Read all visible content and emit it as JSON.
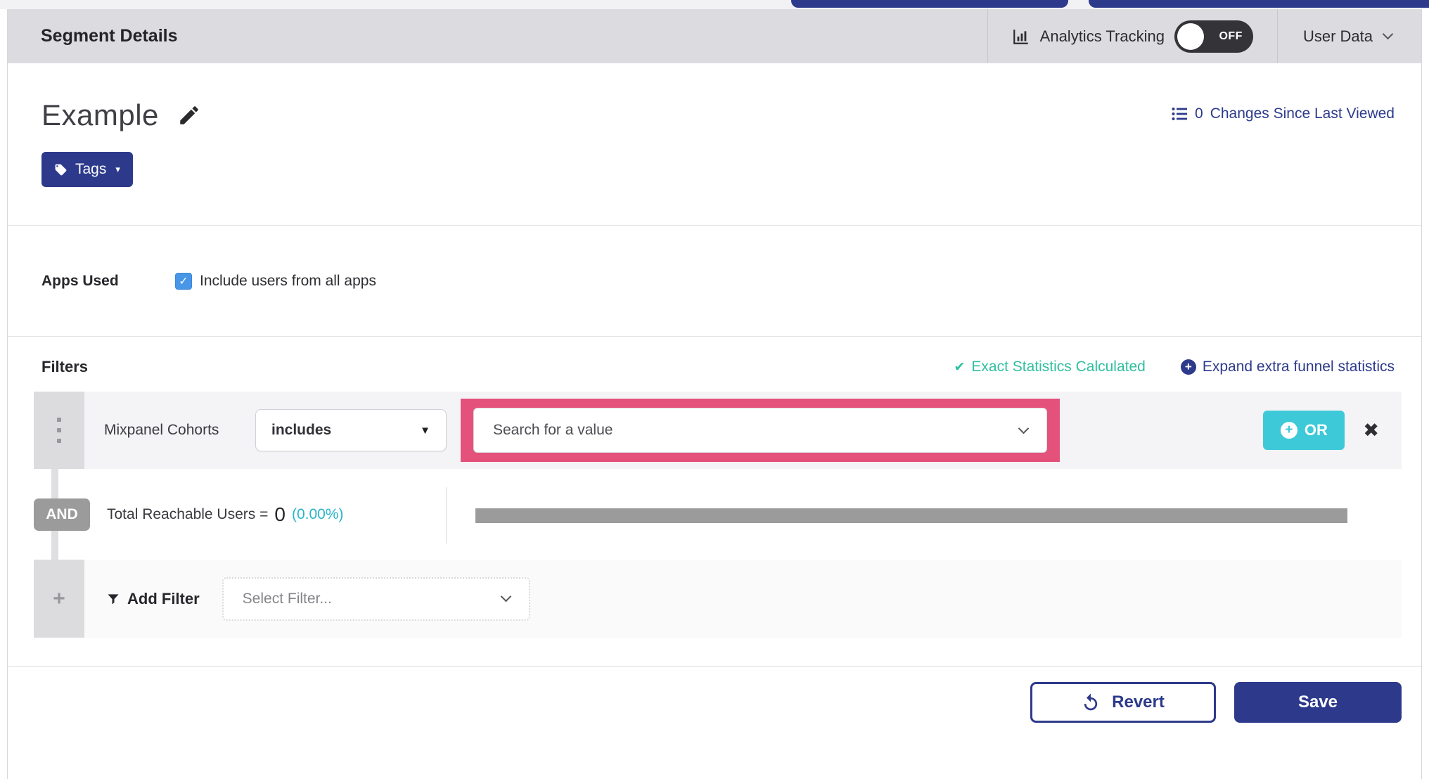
{
  "colors": {
    "primary_indigo": "#2d3a8c",
    "or_teal": "#3ec9d9",
    "success_green": "#2fbf9f",
    "percent_cyan": "#2ab5c8",
    "highlight_pink": "#e4517b",
    "bar_gray": "#9b9b9b",
    "checkbox_blue": "#4896e8",
    "header_band_gray": "#dcdce0",
    "toggle_bg": "#343438"
  },
  "icons": {
    "check": "✔",
    "checkbox_check": "✓",
    "close": "✖",
    "caret_down": "▼",
    "caret_small": "▾",
    "plus": "+"
  },
  "header": {
    "title": "Segment Details",
    "analytics_label": "Analytics Tracking",
    "toggle_state": "OFF",
    "user_data_label": "User Data"
  },
  "segment": {
    "name": "Example",
    "tags_label": "Tags",
    "changes_count": "0",
    "changes_label": "Changes Since Last Viewed"
  },
  "apps": {
    "label": "Apps Used",
    "checkbox_label": "Include users from all apps",
    "checked": true
  },
  "filters": {
    "heading": "Filters",
    "exact_statistics": "Exact Statistics Calculated",
    "expand_link": "Expand extra funnel statistics",
    "row": {
      "field": "Mixpanel Cohorts",
      "operator": "includes",
      "value_placeholder": "Search for a value",
      "or_label": "OR"
    },
    "and_label": "AND",
    "total_label": "Total Reachable Users =",
    "total_value": "0",
    "total_percent": "(0.00%)",
    "add_filter_label": "Add Filter",
    "select_filter_placeholder": "Select Filter..."
  },
  "footer": {
    "revert_label": "Revert",
    "save_label": "Save"
  }
}
